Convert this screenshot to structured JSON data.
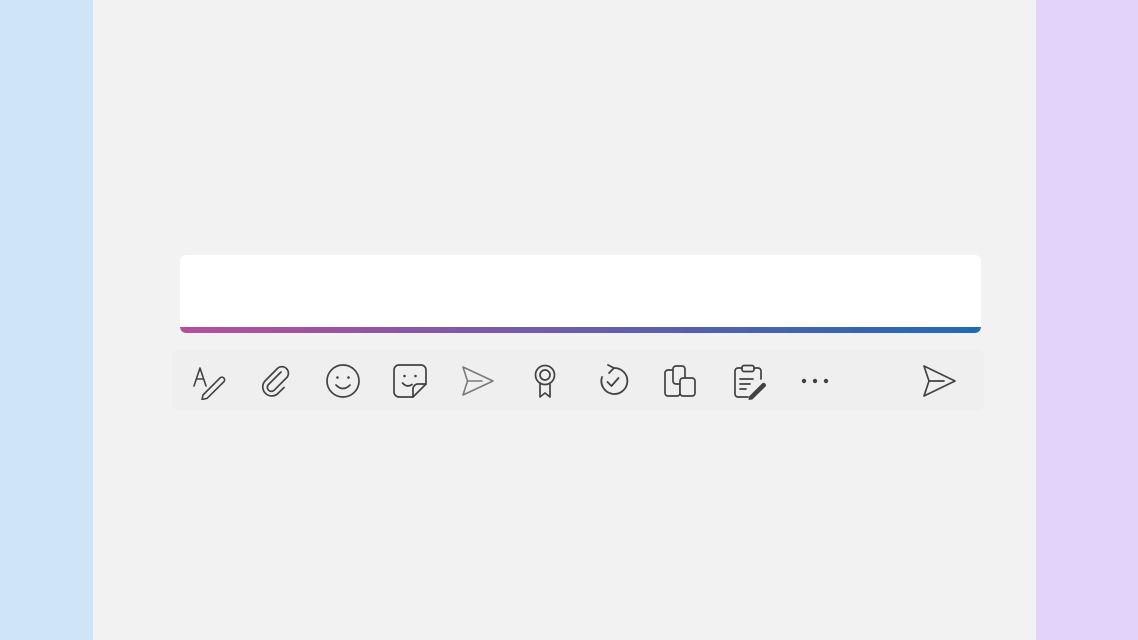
{
  "colors": {
    "page_background": "#f2f2f2",
    "left_panel": "#cfe4f7",
    "right_panel": "#e2d3fb",
    "underline_start": "#b5509b",
    "underline_end": "#1f6ab3",
    "icon": "#424242",
    "icon_muted": "#7a7a7a"
  },
  "compose": {
    "value": "",
    "placeholder": ""
  },
  "toolbar": {
    "items": [
      {
        "icon": "format-text-icon"
      },
      {
        "icon": "attach-icon"
      },
      {
        "icon": "emoji-icon"
      },
      {
        "icon": "sticker-icon"
      },
      {
        "icon": "schedule-send-icon"
      },
      {
        "icon": "praise-icon"
      },
      {
        "icon": "loop-icon"
      },
      {
        "icon": "apps-icon"
      },
      {
        "icon": "clipboard-edit-icon"
      },
      {
        "icon": "more-options-icon"
      }
    ],
    "send": {
      "icon": "send-icon"
    }
  }
}
